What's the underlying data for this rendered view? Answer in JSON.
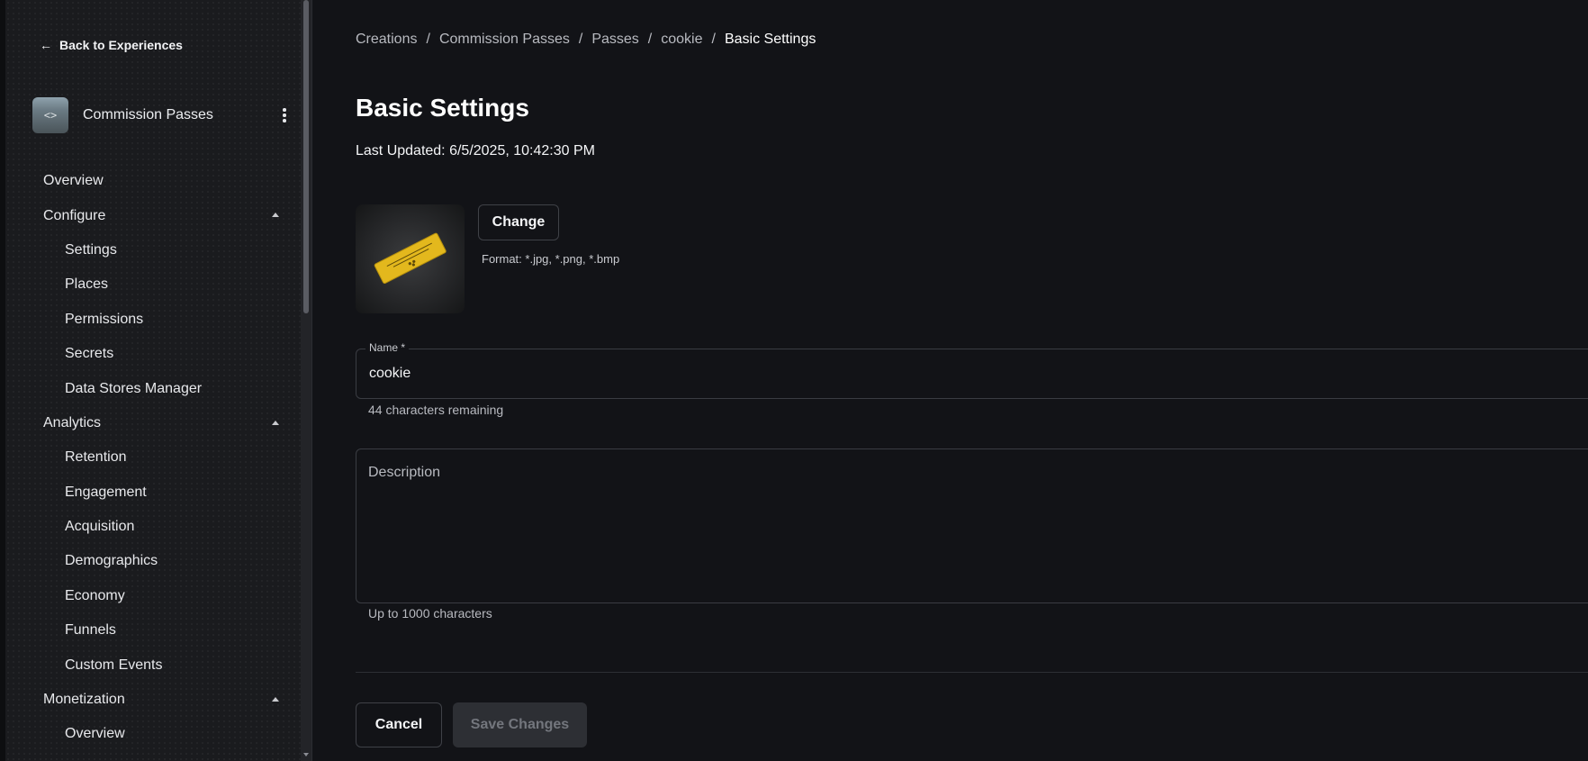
{
  "sidebar": {
    "back_label": "Back to Experiences",
    "experience_name": "Commission Passes",
    "thumb_glyph": "<>",
    "items": [
      {
        "label": "Overview",
        "level": "top"
      },
      {
        "label": "Configure",
        "level": "top",
        "expanded": true
      },
      {
        "label": "Settings",
        "level": "sub"
      },
      {
        "label": "Places",
        "level": "sub"
      },
      {
        "label": "Permissions",
        "level": "sub"
      },
      {
        "label": "Secrets",
        "level": "sub"
      },
      {
        "label": "Data Stores Manager",
        "level": "sub"
      },
      {
        "label": "Analytics",
        "level": "top",
        "expanded": true
      },
      {
        "label": "Retention",
        "level": "sub"
      },
      {
        "label": "Engagement",
        "level": "sub"
      },
      {
        "label": "Acquisition",
        "level": "sub"
      },
      {
        "label": "Demographics",
        "level": "sub"
      },
      {
        "label": "Economy",
        "level": "sub"
      },
      {
        "label": "Funnels",
        "level": "sub"
      },
      {
        "label": "Custom Events",
        "level": "sub"
      },
      {
        "label": "Monetization",
        "level": "top",
        "expanded": true
      },
      {
        "label": "Overview",
        "level": "sub"
      }
    ]
  },
  "breadcrumb": [
    "Creations",
    "Commission Passes",
    "Passes",
    "cookie",
    "Basic Settings"
  ],
  "page": {
    "title": "Basic Settings",
    "last_updated": "Last Updated: 6/5/2025, 10:42:30 PM"
  },
  "image": {
    "change_label": "Change",
    "format_hint": "Format: *.jpg, *.png, *.bmp"
  },
  "name_field": {
    "label": "Name *",
    "value": "cookie",
    "helper": "44 characters remaining"
  },
  "description_field": {
    "placeholder": "Description",
    "value": "",
    "helper": "Up to 1000 characters"
  },
  "actions": {
    "cancel_label": "Cancel",
    "save_label": "Save Changes",
    "save_enabled": false
  },
  "colors": {
    "background": "#121317",
    "sidebar_bg": "#1a1b1e",
    "pass_gold": "#e3b81d",
    "text_primary": "#ffffff",
    "text_muted": "#b8bac0"
  }
}
